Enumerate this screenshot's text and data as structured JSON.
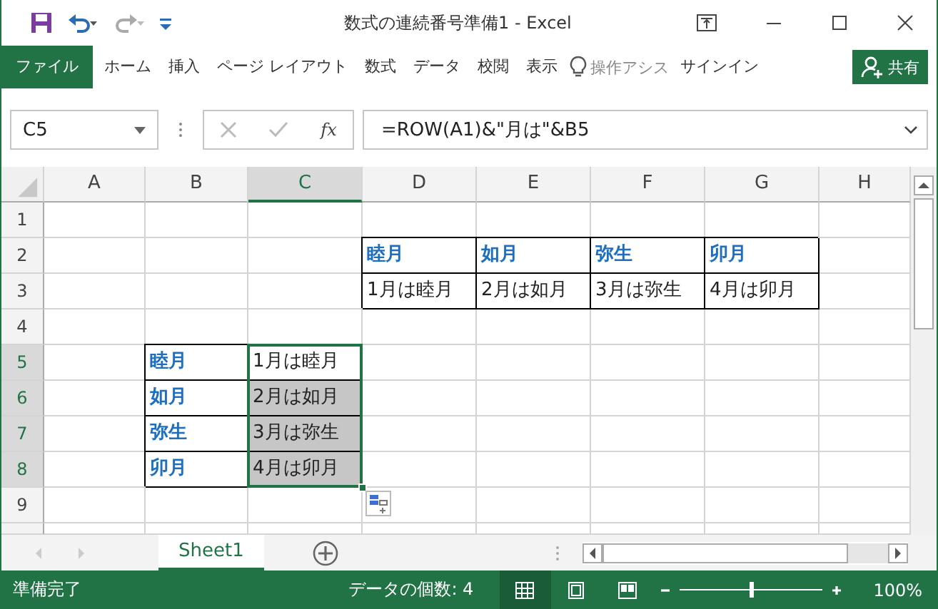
{
  "window": {
    "title": "数式の連続番号準備1 - Excel"
  },
  "ribbon_tabs": [
    {
      "label": "ファイル",
      "kind": "file"
    },
    {
      "label": "ホーム",
      "kind": "tab"
    },
    {
      "label": "挿入",
      "kind": "tab"
    },
    {
      "label": "ページ レイアウト",
      "kind": "tab"
    },
    {
      "label": "数式",
      "kind": "tab"
    },
    {
      "label": "データ",
      "kind": "tab"
    },
    {
      "label": "校閲",
      "kind": "tab"
    },
    {
      "label": "表示",
      "kind": "tab"
    }
  ],
  "tell_me": {
    "placeholder": "操作アシス"
  },
  "sign_in": "サインイン",
  "share_button": "共有",
  "formula_bar": {
    "name_box": "C5",
    "fx": "fx",
    "formula": "=ROW(A1)&\"月は\"&B5"
  },
  "columns": [
    {
      "label": "A",
      "selected": false
    },
    {
      "label": "B",
      "selected": false
    },
    {
      "label": "C",
      "selected": true
    },
    {
      "label": "D",
      "selected": false
    },
    {
      "label": "E",
      "selected": false
    },
    {
      "label": "F",
      "selected": false
    },
    {
      "label": "G",
      "selected": false
    },
    {
      "label": "H",
      "selected": false
    }
  ],
  "rows": [
    {
      "label": "1",
      "selected": false,
      "cells": [
        {},
        {},
        {},
        {},
        {},
        {},
        {},
        {}
      ]
    },
    {
      "label": "2",
      "selected": false,
      "cells": [
        {},
        {},
        {},
        {
          "text": "睦月",
          "kind": "label",
          "boxed": true
        },
        {
          "text": "如月",
          "kind": "label",
          "boxed": true
        },
        {
          "text": "弥生",
          "kind": "label",
          "boxed": true
        },
        {
          "text": "卯月",
          "kind": "label",
          "boxed": true
        },
        {}
      ]
    },
    {
      "label": "3",
      "selected": false,
      "cells": [
        {},
        {},
        {},
        {
          "text": "1月は睦月",
          "kind": "value",
          "boxed": true
        },
        {
          "text": "2月は如月",
          "kind": "value",
          "boxed": true
        },
        {
          "text": "3月は弥生",
          "kind": "value",
          "boxed": true
        },
        {
          "text": "4月は卯月",
          "kind": "value",
          "boxed": true
        },
        {}
      ]
    },
    {
      "label": "4",
      "selected": false,
      "cells": [
        {},
        {},
        {},
        {},
        {},
        {},
        {},
        {}
      ]
    },
    {
      "label": "5",
      "selected": true,
      "cells": [
        {},
        {
          "text": "睦月",
          "kind": "label",
          "boxed": true
        },
        {
          "text": "1月は睦月",
          "kind": "value",
          "boxed": true,
          "selected": true,
          "active": true
        },
        {},
        {},
        {},
        {},
        {}
      ]
    },
    {
      "label": "6",
      "selected": true,
      "cells": [
        {},
        {
          "text": "如月",
          "kind": "label",
          "boxed": true
        },
        {
          "text": "2月は如月",
          "kind": "value",
          "boxed": true,
          "selected": true,
          "active": false
        },
        {},
        {},
        {},
        {},
        {}
      ]
    },
    {
      "label": "7",
      "selected": true,
      "cells": [
        {},
        {
          "text": "弥生",
          "kind": "label",
          "boxed": true
        },
        {
          "text": "3月は弥生",
          "kind": "value",
          "boxed": true,
          "selected": true,
          "active": false
        },
        {},
        {},
        {},
        {},
        {}
      ]
    },
    {
      "label": "8",
      "selected": true,
      "cells": [
        {},
        {
          "text": "卯月",
          "kind": "label",
          "boxed": true
        },
        {
          "text": "4月は卯月",
          "kind": "value",
          "boxed": true,
          "selected": true,
          "active": false
        },
        {},
        {},
        {},
        {},
        {}
      ]
    },
    {
      "label": "9",
      "selected": false,
      "cells": [
        {},
        {},
        {},
        {},
        {},
        {},
        {},
        {}
      ]
    }
  ],
  "sheet_tabs": [
    {
      "label": "Sheet1",
      "selected": true
    }
  ],
  "status_bar": {
    "status": "準備完了",
    "count": "データの個数: 4",
    "views": [
      {
        "kind": "normal",
        "selected": true
      },
      {
        "kind": "page_layout",
        "selected": false
      },
      {
        "kind": "page_break",
        "selected": false
      }
    ],
    "zoom": {
      "level": 0.5,
      "reading": "100%"
    }
  }
}
